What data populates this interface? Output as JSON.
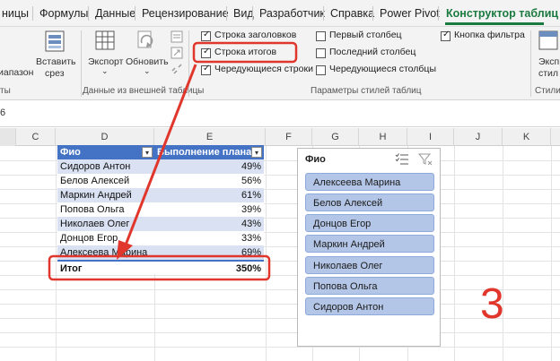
{
  "tabs": [
    "ницы",
    "Формулы",
    "Данные",
    "Рецензирование",
    "Вид",
    "Разработчик",
    "Справка",
    "Power Pivot",
    "Конструктор таблиц"
  ],
  "ribbon": {
    "range_label": "иапазон",
    "insert_slicer": [
      "Вставить",
      "срез"
    ],
    "export": "Экспорт",
    "refresh": "Обновить",
    "group_external": "Данные из внешней таблицы",
    "group_tools_tail": "ты",
    "opt_header_row": "Строка заголовков",
    "opt_total_row": "Строка итогов",
    "opt_banded_rows": "Чередующиеся строки",
    "opt_first_col": "Первый столбец",
    "opt_last_col": "Последний столбец",
    "opt_banded_cols": "Чередующиеся столбцы",
    "opt_filter_btn": "Кнопка фильтра",
    "group_style_options": "Параметры стилей таблиц",
    "right_big_1": "Экспр",
    "right_big_2": "стил",
    "right_group": "Стили т"
  },
  "formula_bar": {
    "name_box": "6"
  },
  "columns": [
    "C",
    "D",
    "E",
    "F",
    "G",
    "H",
    "I",
    "J",
    "K"
  ],
  "table": {
    "header_name": "Фио",
    "header_value": "Выполнение плана",
    "rows": [
      {
        "name": "Сидоров Антон",
        "value": "49%"
      },
      {
        "name": "Белов Алексей",
        "value": "56%"
      },
      {
        "name": "Маркин Андрей",
        "value": "61%"
      },
      {
        "name": "Попова Ольга",
        "value": "39%"
      },
      {
        "name": "Николаев Олег",
        "value": "43%"
      },
      {
        "name": "Донцов Егор",
        "value": "33%"
      },
      {
        "name": "Алексеева Марина",
        "value": "69%"
      }
    ],
    "total_label": "Итог",
    "total_value": "350%"
  },
  "slicer": {
    "title": "Фио",
    "items": [
      "Алексеева Марина",
      "Белов Алексей",
      "Донцов Егор",
      "Маркин Андрей",
      "Николаев Олег",
      "Попова Ольга",
      "Сидоров Антон"
    ]
  },
  "overlay_number": "3",
  "colors": {
    "accent_green": "#1b7a3f",
    "annotation_red": "#e0362b",
    "band": "#d9e1f2",
    "header_blue": "#4472c4",
    "slicer_item": "#b4c6e7"
  }
}
